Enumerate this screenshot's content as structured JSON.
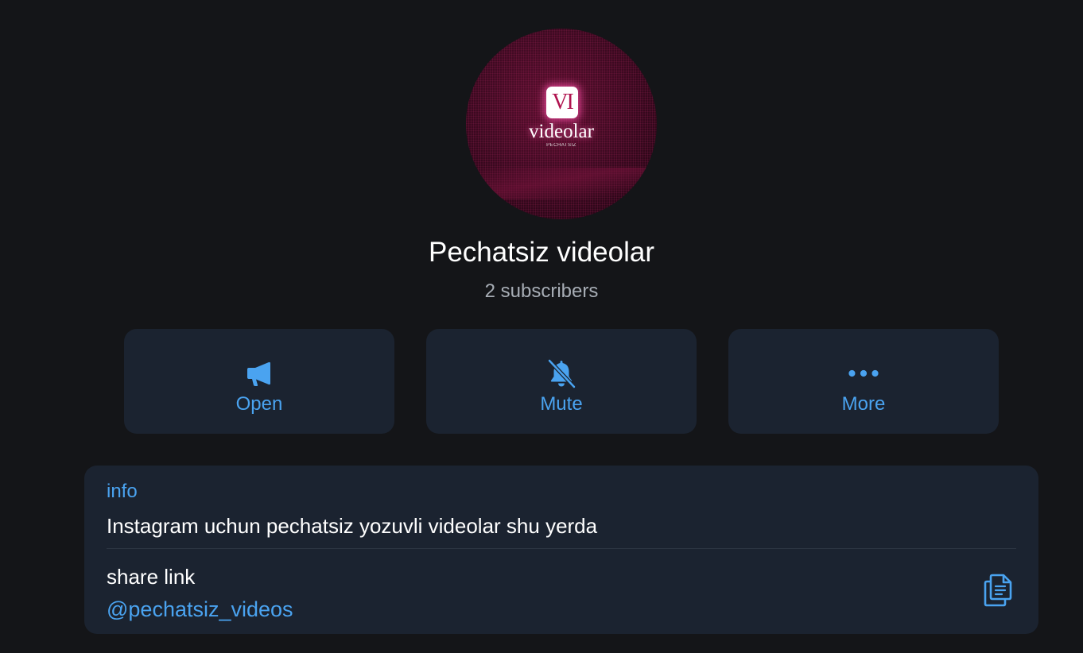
{
  "channel": {
    "avatar": {
      "logo_mark": "VI",
      "logo_word": "videolar",
      "logo_sub": "PECHATSIZ",
      "colors": {
        "background": "#3f0a22",
        "glow": "#ff50aa"
      }
    },
    "title": "Pechatsiz videolar",
    "subscribers": "2 subscribers"
  },
  "actions": [
    {
      "label": "Open",
      "icon": "megaphone-icon"
    },
    {
      "label": "Mute",
      "icon": "bell-off-icon"
    },
    {
      "label": "More",
      "icon": "more-dots-icon"
    }
  ],
  "info": {
    "label": "info",
    "text": "Instagram uchun pechatsiz yozuvli videolar shu yerda",
    "share_label": "share link",
    "share_value": "@pechatsiz_videos",
    "copy_icon": "copy-icon"
  },
  "colors": {
    "background": "#141518",
    "card": "#1b2330",
    "accent": "#4aa3f0",
    "secondary_text": "#a7adb5"
  }
}
